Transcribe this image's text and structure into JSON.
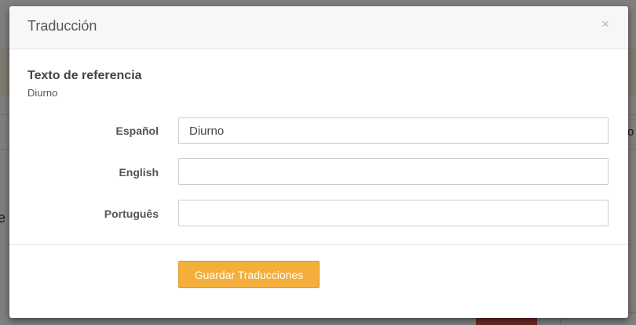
{
  "modal": {
    "title": "Traducción",
    "close_symbol": "×",
    "reference": {
      "title": "Texto de referencia",
      "value": "Diurno"
    },
    "fields": [
      {
        "label": "Español",
        "value": "Diurno"
      },
      {
        "label": "English",
        "value": ""
      },
      {
        "label": "Português",
        "value": ""
      }
    ],
    "save_button_label": "Guardar Traducciones"
  },
  "background": {
    "left_fragment": "e",
    "right_fragment": "o"
  },
  "colors": {
    "save_button": "#f3ae3c",
    "header_bg": "#f7f7f7",
    "background_alert": "#fcf8e3",
    "background_danger_button": "#d9534f"
  },
  "icons": {
    "close": "close-icon"
  }
}
